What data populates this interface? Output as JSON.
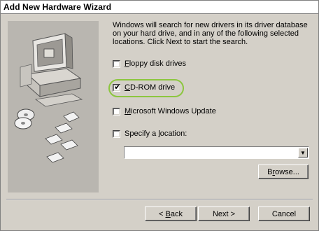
{
  "window": {
    "title": "Add New Hardware Wizard"
  },
  "main": {
    "description": "Windows will search for new drivers in its driver database on your hard drive, and in any of the following selected locations. Click Next to start the search.",
    "options": [
      {
        "label_pre": "",
        "label_key": "F",
        "label_post": "loppy disk drives",
        "checked": false
      },
      {
        "label_pre": "",
        "label_key": "C",
        "label_post": "D-ROM drive",
        "checked": true
      },
      {
        "label_pre": "",
        "label_key": "M",
        "label_post": "icrosoft Windows Update",
        "checked": false
      },
      {
        "label_pre": "Specify a ",
        "label_key": "l",
        "label_post": "ocation:",
        "checked": false
      }
    ],
    "location_value": "",
    "browse": {
      "pre": "B",
      "key": "r",
      "post": "owse..."
    }
  },
  "buttons": {
    "back": {
      "pre": "< ",
      "key": "B",
      "post": "ack"
    },
    "next": "Next >",
    "cancel": "Cancel"
  },
  "colors": {
    "highlight": "#8cc63f",
    "face": "#d4d0c8"
  }
}
